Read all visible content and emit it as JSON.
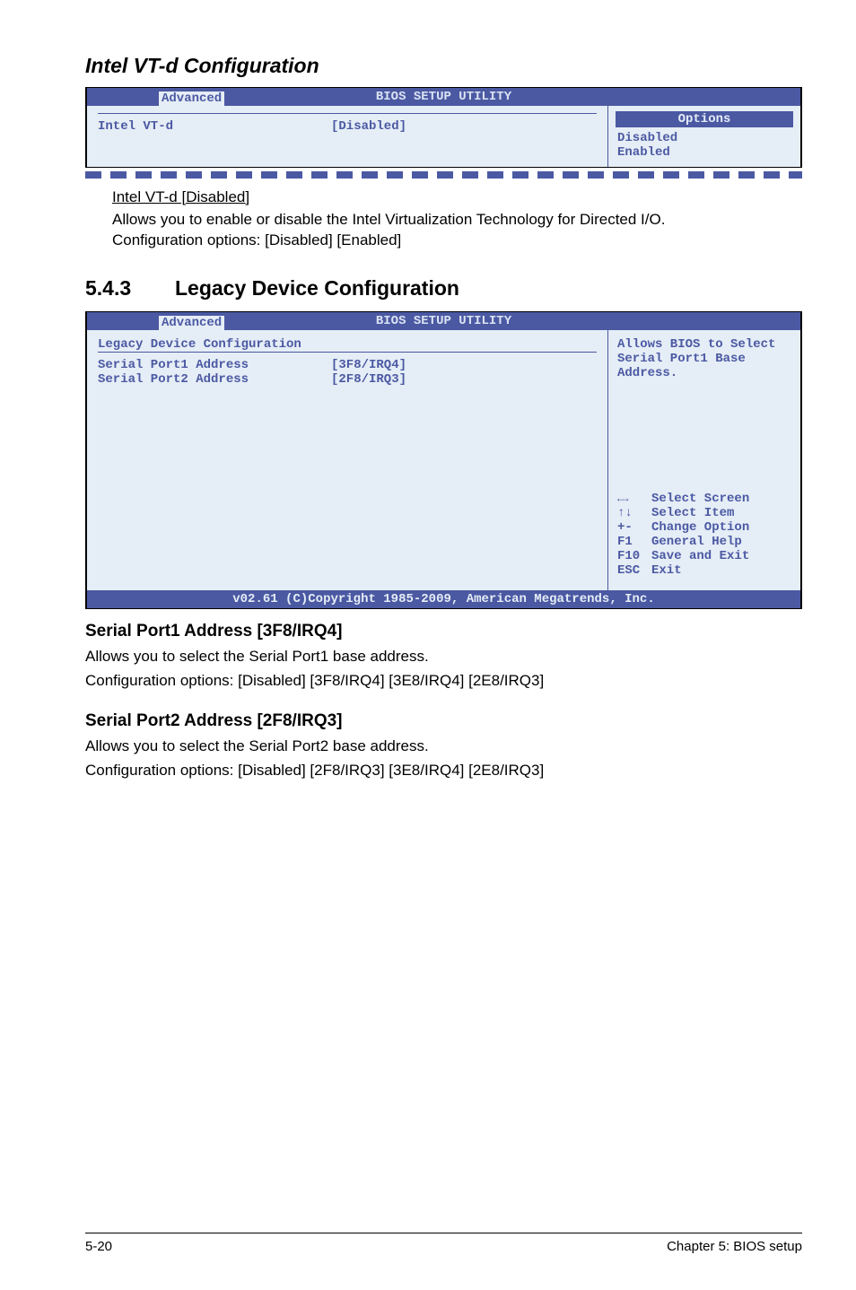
{
  "section1": {
    "title": "Intel VT-d Configuration",
    "bios": {
      "header": "BIOS SETUP UTILITY",
      "tab": "Advanced",
      "left": {
        "item_label": "Intel VT-d",
        "item_value": "[Disabled]"
      },
      "right": {
        "options_header": "Options",
        "opt1": "Disabled",
        "opt2": "Enabled"
      }
    },
    "note": {
      "underline": "Intel VT-d [Disabled]",
      "line1": "Allows you to enable or disable the Intel Virtualization Technology for Directed I/O.",
      "line2": "Configuration options: [Disabled] [Enabled]"
    }
  },
  "section2": {
    "num": "5.4.3",
    "title": "Legacy Device Configuration",
    "bios": {
      "header": "BIOS SETUP UTILITY",
      "tab": "Advanced",
      "left": {
        "heading": "Legacy Device Configuration",
        "item1_label": "Serial Port1 Address",
        "item1_value": "[3F8/IRQ4]",
        "item2_label": "Serial Port2 Address",
        "item2_value": "[2F8/IRQ3]"
      },
      "right": {
        "help": "Allows BIOS to Select Serial Port1 Base Address.",
        "nav": {
          "k1": "",
          "v1": "Select Screen",
          "k2": "↑↓",
          "v2": "Select Item",
          "k3": "+-",
          "v3": "Change Option",
          "k4": "F1",
          "v4": "General Help",
          "k5": "F10",
          "v5": "Save and Exit",
          "k6": "ESC",
          "v6": "Exit"
        }
      },
      "footer": "v02.61 (C)Copyright 1985-2009, American Megatrends, Inc."
    },
    "sub1": {
      "title": "Serial Port1 Address [3F8/IRQ4]",
      "line1": "Allows you to select the Serial Port1 base address.",
      "line2": "Configuration options: [Disabled] [3F8/IRQ4] [3E8/IRQ4] [2E8/IRQ3]"
    },
    "sub2": {
      "title": "Serial Port2 Address [2F8/IRQ3]",
      "line1": "Allows you to select the Serial Port2 base address.",
      "line2": "Configuration options: [Disabled] [2F8/IRQ3] [3E8/IRQ4] [2E8/IRQ3]"
    }
  },
  "footer": {
    "left": "5-20",
    "right": "Chapter 5: BIOS setup"
  }
}
